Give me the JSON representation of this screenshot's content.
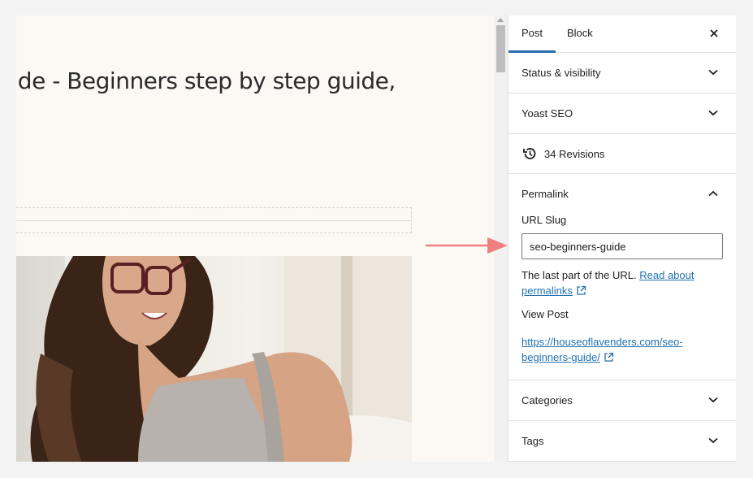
{
  "editor": {
    "post_title": "guide - Beginners step by step guide,"
  },
  "sidebar": {
    "tabs": [
      {
        "label": "Post",
        "active": true
      },
      {
        "label": "Block",
        "active": false
      }
    ],
    "close_icon": "close-icon",
    "panels": {
      "status_visibility": "Status & visibility",
      "yoast_seo": "Yoast SEO",
      "revisions": "34 Revisions",
      "permalink": "Permalink",
      "categories": "Categories",
      "tags": "Tags"
    },
    "permalink": {
      "url_slug_label": "URL Slug",
      "url_slug_value": "seo-beginners-guide",
      "help_text": "The last part of the URL.",
      "help_link_line1": "Read about",
      "help_link_line2": "permalinks",
      "view_post_label": "View Post",
      "view_post_url_line1": "https://houseoflavenders.com/seo-",
      "view_post_url_line2": "beginners-guide/"
    }
  },
  "colors": {
    "accent": "#2271b1",
    "arrow": "#f08080",
    "canvas": "#fcf9f5"
  }
}
